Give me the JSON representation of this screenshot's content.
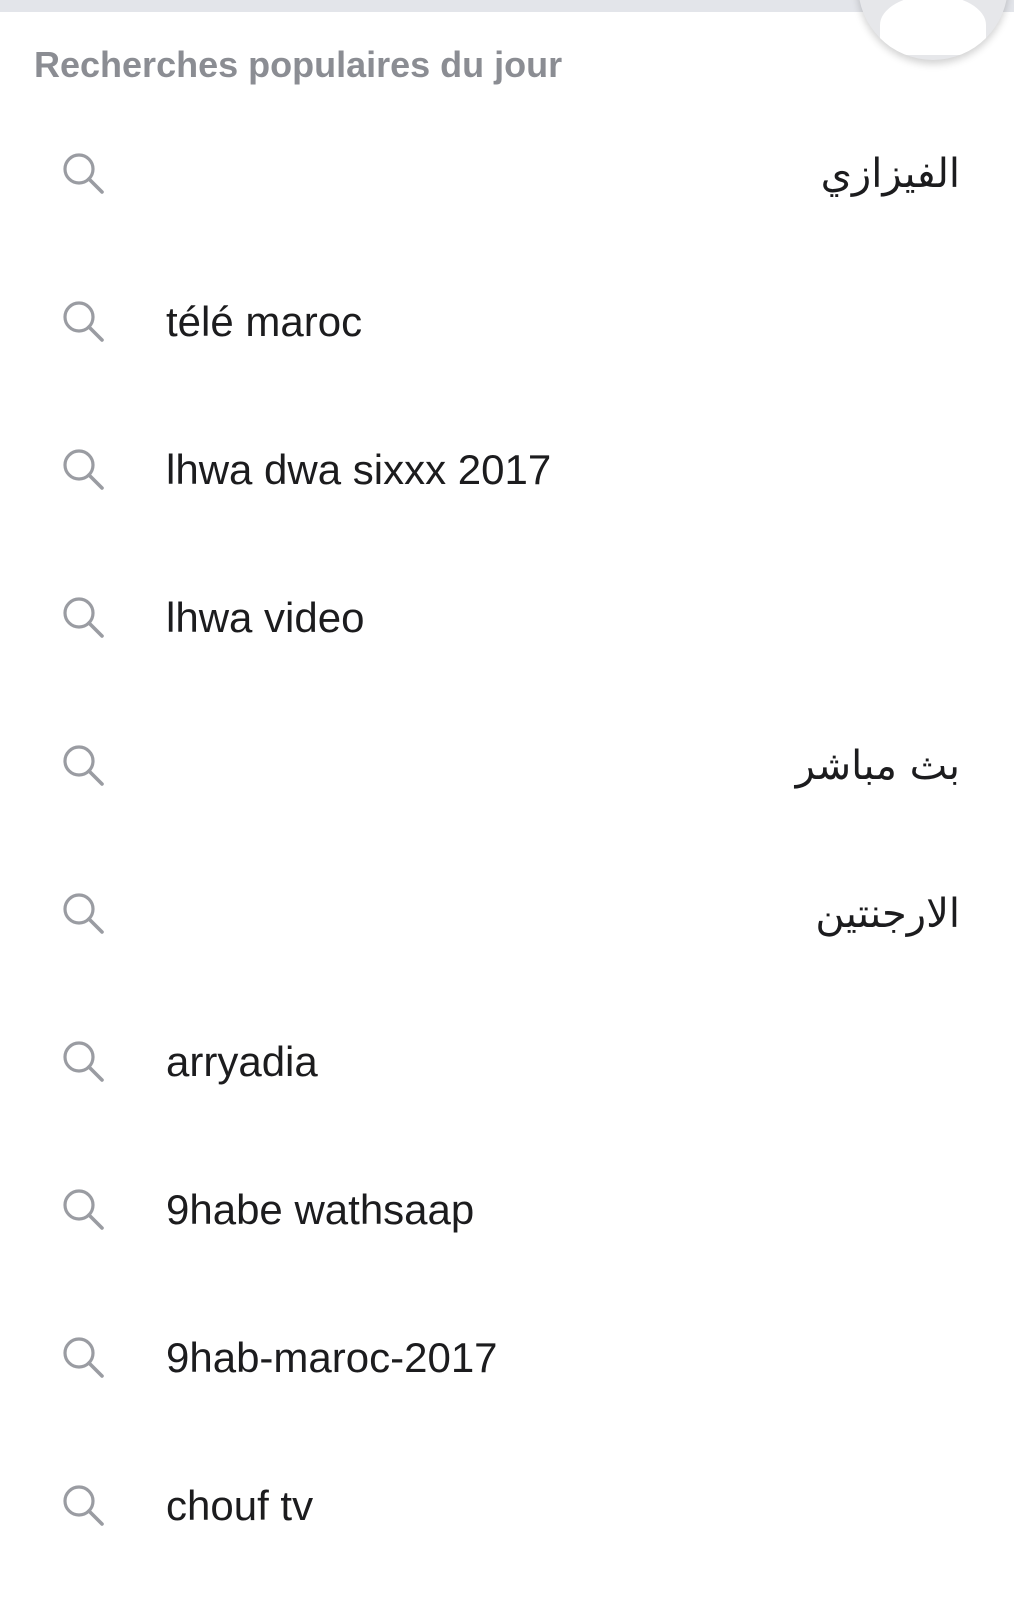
{
  "trending": {
    "title": "Recherches populaires du jour",
    "items": [
      {
        "label": "الفيزازي",
        "dir": "rtl"
      },
      {
        "label": "télé maroc",
        "dir": "ltr"
      },
      {
        "label": "lhwa dwa sixxx 2017",
        "dir": "ltr"
      },
      {
        "label": "lhwa video",
        "dir": "ltr"
      },
      {
        "label": "بث مباشر",
        "dir": "rtl"
      },
      {
        "label": "الارجنتين",
        "dir": "rtl"
      },
      {
        "label": "arryadia",
        "dir": "ltr"
      },
      {
        "label": "9habe wathsaap",
        "dir": "ltr"
      },
      {
        "label": "9hab-maroc-2017",
        "dir": "ltr"
      },
      {
        "label": "chouf tv",
        "dir": "ltr"
      }
    ]
  },
  "icons": {
    "row_icon": "search-icon",
    "profile": "avatar-placeholder-icon"
  },
  "colors": {
    "title_text": "#8b8d93",
    "item_text": "#1c1c1e",
    "icon_stroke": "#9a9ca2",
    "top_bar": "#e3e5ea"
  }
}
